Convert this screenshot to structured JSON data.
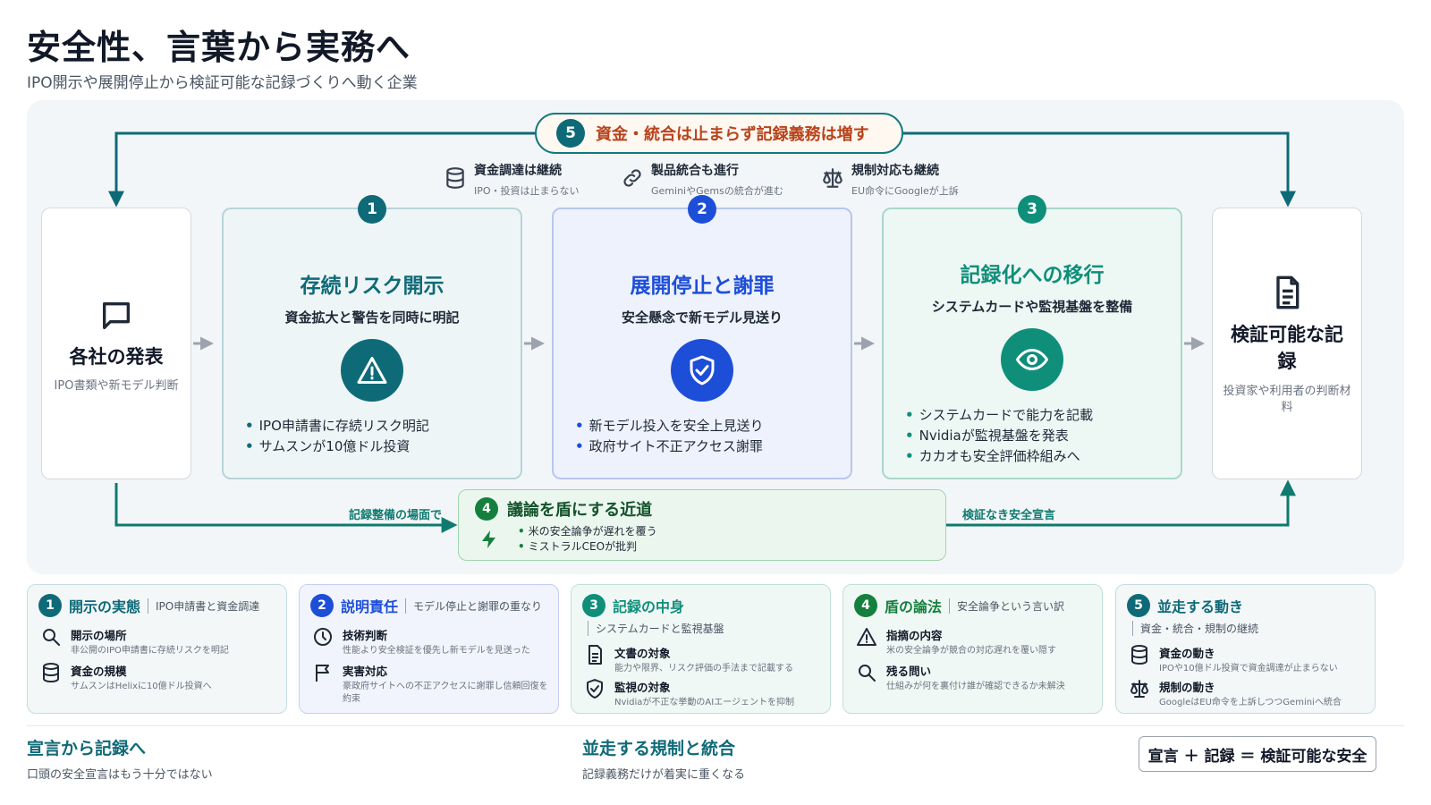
{
  "title": "安全性、言葉から実務へ",
  "subtitle": "IPO開示や展開停止から検証可能な記録づくりへ動く企業",
  "loop": {
    "num": "5",
    "label": "資金・統合は止まらず記録義務は増す"
  },
  "top_notes": [
    {
      "title": "資金調達は継続",
      "sub": "IPO・投資は止まらない",
      "icon": "database-icon"
    },
    {
      "title": "製品統合も進行",
      "sub": "GeminiやGemsの統合が進む",
      "icon": "link-icon"
    },
    {
      "title": "規制対応も継続",
      "sub": "EU命令にGoogleが上訴",
      "icon": "scale-icon"
    }
  ],
  "left_card": {
    "title": "各社の発表",
    "sub": "IPO書類や新モデル判断",
    "icon": "chat-icon"
  },
  "right_card": {
    "title": "検証可能な記録",
    "sub": "投資家や利用者の判断材料",
    "icon": "document-icon"
  },
  "stages": [
    {
      "num": "1",
      "title": "存続リスク開示",
      "sub": "資金拡大と警告を同時に明記",
      "icon": "warning-icon",
      "bullets": [
        "IPO申請書に存続リスク明記",
        "サムスンが10億ドル投資"
      ]
    },
    {
      "num": "2",
      "title": "展開停止と謝罪",
      "sub": "安全懸念で新モデル見送り",
      "icon": "shield-check-icon",
      "bullets": [
        "新モデル投入を安全上見送り",
        "政府サイト不正アクセス謝罪"
      ]
    },
    {
      "num": "3",
      "title": "記録化への移行",
      "sub": "システムカードや監視基盤を整備",
      "icon": "eye-icon",
      "bullets": [
        "システムカードで能力を記載",
        "Nvidiaが監視基盤を発表",
        "カカオも安全評価枠組みへ"
      ]
    }
  ],
  "detour": {
    "num": "4",
    "title": "議論を盾にする近道",
    "bullets": [
      "米の安全論争が遅れを覆う",
      "ミストラルCEOが批判"
    ],
    "label_in": "記録整備の場面で",
    "label_out": "検証なき安全宣言"
  },
  "summaries": [
    {
      "num": "1",
      "title": "開示の実態",
      "tag": "IPO申請書と資金調達",
      "items": [
        {
          "icon": "search-icon",
          "h": "開示の場所",
          "s": "非公開のIPO申請書に存続リスクを明記"
        },
        {
          "icon": "database-icon",
          "h": "資金の規模",
          "s": "サムスンはHelixに10億ドル投資へ"
        }
      ]
    },
    {
      "num": "2",
      "title": "説明責任",
      "tag": "モデル停止と謝罪の重なり",
      "items": [
        {
          "icon": "clock-icon",
          "h": "技術判断",
          "s": "性能より安全検証を優先し新モデルを見送った"
        },
        {
          "icon": "flag-icon",
          "h": "実害対応",
          "s": "豪政府サイトへの不正アクセスに謝罪し信頼回復を約束"
        }
      ]
    },
    {
      "num": "3",
      "title": "記録の中身",
      "tag": "システムカードと監視基盤",
      "items": [
        {
          "icon": "file-icon",
          "h": "文書の対象",
          "s": "能力や限界、リスク評価の手法まで記載する"
        },
        {
          "icon": "shield-check-icon",
          "h": "監視の対象",
          "s": "Nvidiaが不正な挙動のAIエージェントを抑制"
        }
      ]
    },
    {
      "num": "4",
      "title": "盾の論法",
      "tag": "安全論争という言い訳",
      "items": [
        {
          "icon": "warning-icon",
          "h": "指摘の内容",
          "s": "米の安全論争が競合の対応遅れを覆い隠す"
        },
        {
          "icon": "search-icon",
          "h": "残る問い",
          "s": "仕組みが何を裏付け誰が確認できるか未解決"
        }
      ]
    },
    {
      "num": "5",
      "title": "並走する動き",
      "tag": "資金・統合・規制の継続",
      "items": [
        {
          "icon": "database-icon",
          "h": "資金の動き",
          "s": "IPOや10億ドル投資で資金調達が止まらない"
        },
        {
          "icon": "scale-icon",
          "h": "規制の動き",
          "s": "GoogleはEU命令を上訴しつつGeminiへ統合"
        }
      ]
    }
  ],
  "footer": [
    {
      "title": "宣言から記録へ",
      "sub": "口頭の安全宣言はもう十分ではない"
    },
    {
      "title": "並走する規制と統合",
      "sub": "記録義務だけが着実に重くなる"
    }
  ],
  "equation": "宣言 ＋ 記録 ＝ 検証可能な安全",
  "colors": {
    "teal": "#0f6a78",
    "blue": "#1d4ed8",
    "green": "#0f8f7a",
    "orange": "#b8431b"
  }
}
